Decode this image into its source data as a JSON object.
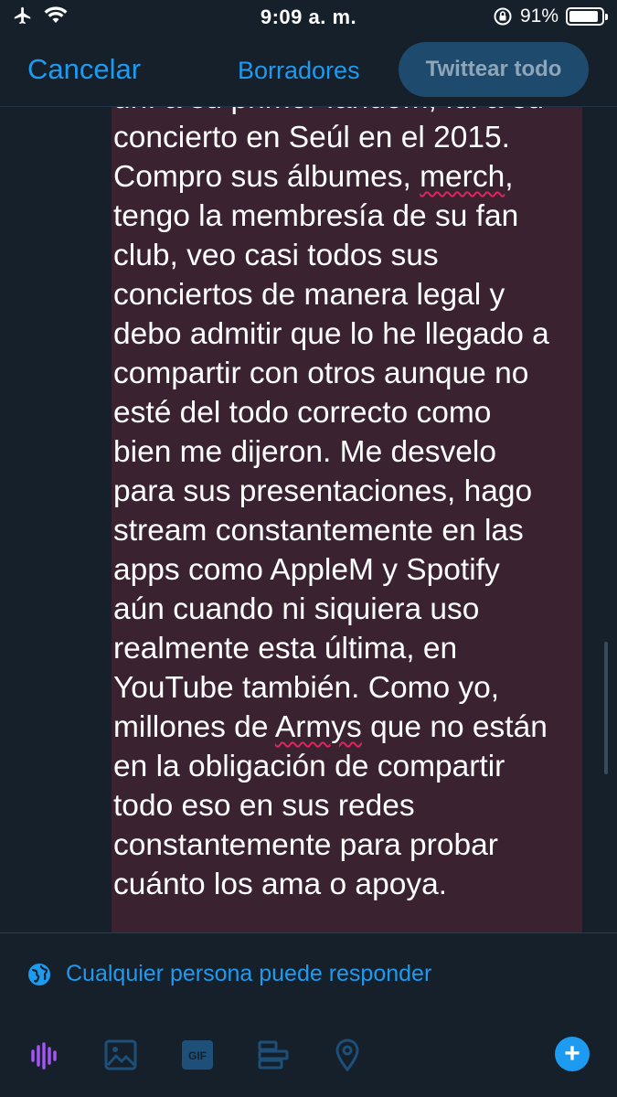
{
  "status_bar": {
    "time": "9:09 a. m.",
    "battery_percent": "91%",
    "battery_level": 0.91
  },
  "nav": {
    "cancel_label": "Cancelar",
    "drafts_label": "Borradores",
    "tweet_all_label": "Twittear todo"
  },
  "tweet": {
    "lines": [
      "uní a su primer fandom, fui a su",
      "concierto en Seúl en el 2015.",
      "Compro sus álbumes, merch,",
      "tengo la membresía de su fan",
      "club, veo casi todos sus",
      "conciertos de manera legal y",
      "debo admitir que lo he llegado a",
      "compartir con otros aunque no",
      "esté del todo correcto como",
      "bien me dijeron. Me desvelo",
      "para sus presentaciones, hago",
      "stream constantemente en las",
      "apps como AppleM y Spotify",
      "aún cuando ni siquiera uso",
      "realmente esta última, en",
      "YouTube también. Como yo,",
      "millones de Armys que no están",
      "en la obligación de compartir",
      "todo eso en sus redes",
      "constantemente para probar",
      "cuánto los ama o apoya."
    ],
    "line3_before": "Compro sus álbumes, ",
    "line3_flagged": "merch",
    "line3_after": ",",
    "line17_before": "millones de ",
    "line17_flagged": "Armys",
    "line17_after": " que no están"
  },
  "reply_setting": {
    "label": "Cualquier persona puede responder",
    "icon": "globe-icon"
  },
  "toolbar": {
    "icons": [
      "voice-icon",
      "image-icon",
      "gif-icon",
      "poll-icon",
      "location-icon",
      "add-icon"
    ],
    "gif_label": "GIF",
    "add_label": "+"
  },
  "colors": {
    "background": "#15202b",
    "accent": "#1d9bf0",
    "tweet_highlight": "#3a2231",
    "spell_underline": "#e0245e"
  }
}
